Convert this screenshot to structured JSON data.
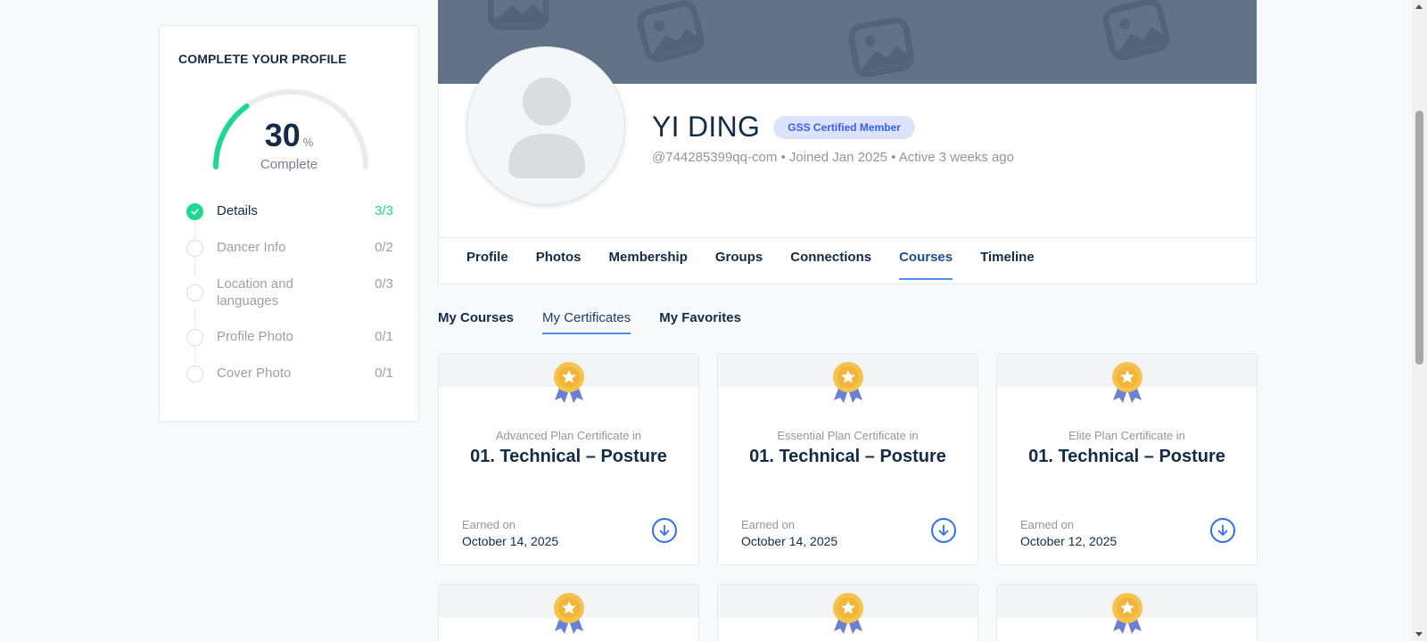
{
  "completion": {
    "title": "COMPLETE YOUR PROFILE",
    "percent": "30",
    "percent_sign": "%",
    "percent_value": 30,
    "complete_label": "Complete",
    "steps": [
      {
        "label": "Details",
        "count": "3/3",
        "done": true
      },
      {
        "label": "Dancer Info",
        "count": "0/2",
        "done": false
      },
      {
        "label": "Location and languages",
        "count": "0/3",
        "done": false
      },
      {
        "label": "Profile Photo",
        "count": "0/1",
        "done": false
      },
      {
        "label": "Cover Photo",
        "count": "0/1",
        "done": false
      }
    ]
  },
  "profile": {
    "name": "YI DING",
    "badge": "GSS Certified Member",
    "meta": "@744285399qq-com • Joined Jan 2025 • Active 3 weeks ago"
  },
  "tabs": [
    "Profile",
    "Photos",
    "Membership",
    "Groups",
    "Connections",
    "Courses",
    "Timeline"
  ],
  "active_tab": "Courses",
  "subtabs": [
    "My Courses",
    "My Certificates",
    "My Favorites"
  ],
  "active_subtab": "My Certificates",
  "certificates": [
    {
      "plan": "Advanced Plan Certificate in",
      "course": "01. Technical – Posture",
      "earned_label": "Earned on",
      "date": "October 14, 2025"
    },
    {
      "plan": "Essential Plan Certificate in",
      "course": "01. Technical – Posture",
      "earned_label": "Earned on",
      "date": "October 14, 2025"
    },
    {
      "plan": "Elite Plan Certificate in",
      "course": "01. Technical – Posture",
      "earned_label": "Earned on",
      "date": "October 12, 2025"
    }
  ],
  "colors": {
    "accent": "#1cd991",
    "link": "#2e6ff0",
    "cover": "#627387",
    "text": "#122b46"
  },
  "icons": {
    "check": "check-icon",
    "medal": "award-medal-icon",
    "download": "download-icon",
    "avatar": "user-placeholder-icon",
    "cover": "image-placeholder-icon"
  }
}
